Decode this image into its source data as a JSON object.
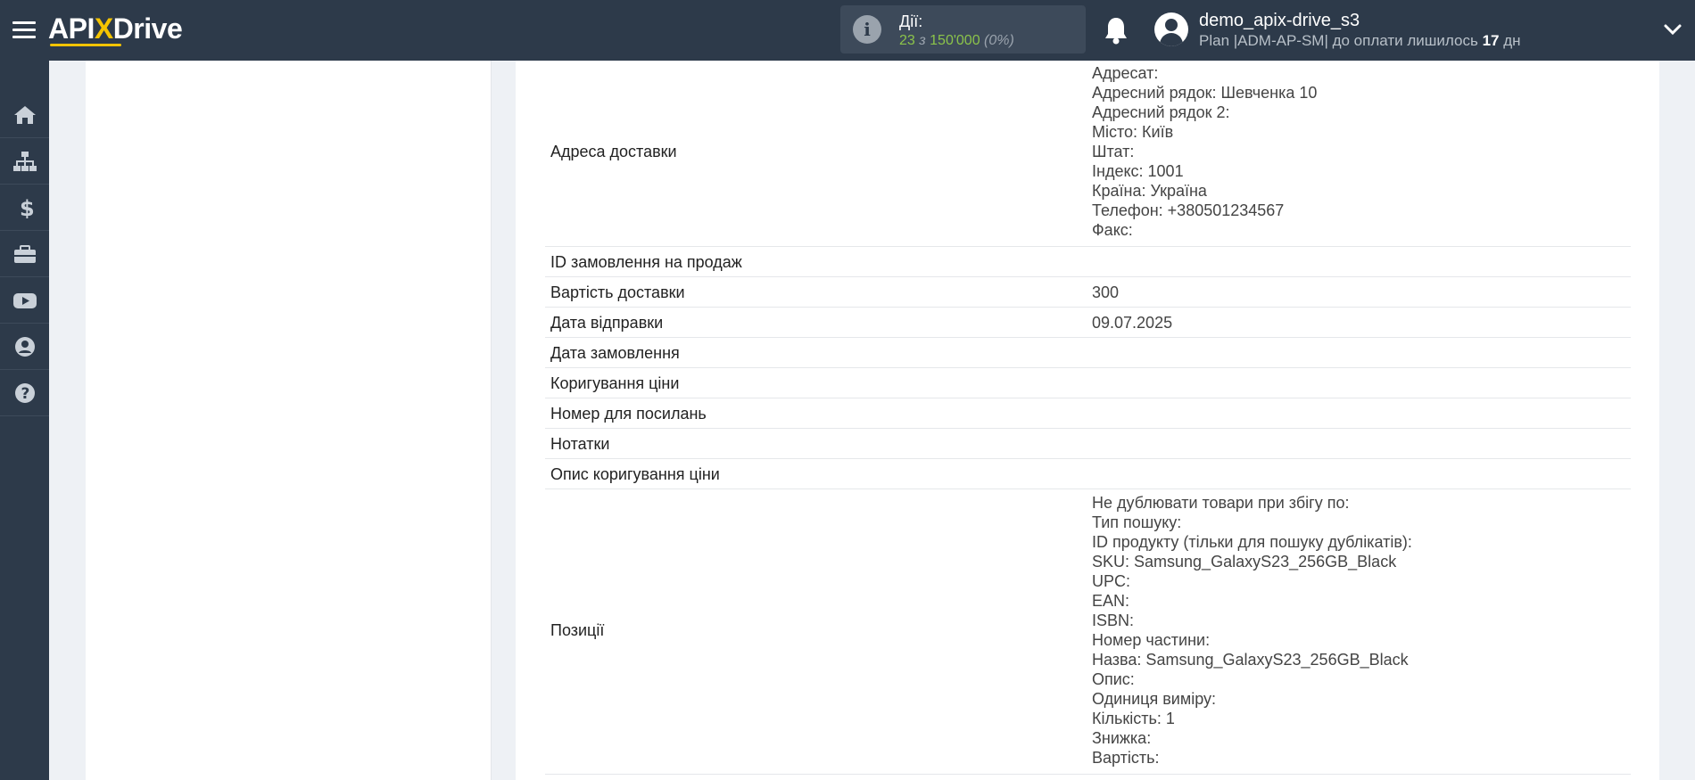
{
  "header": {
    "logo_prefix": "API",
    "logo_x": "X",
    "logo_suffix": "Drive",
    "actions_label": "Дії:",
    "actions_used": "23",
    "actions_of": "з",
    "actions_total": "150'000",
    "actions_percent": "(0%)",
    "user_name": "demo_apix-drive_s3",
    "plan_text": "Plan |ADM-AP-SM| до оплати лишилось",
    "days_left": "17",
    "days_unit": "дн"
  },
  "sidebar": {
    "items": [
      {
        "icon": "home-icon"
      },
      {
        "icon": "sitemap-icon"
      },
      {
        "icon": "dollar-icon"
      },
      {
        "icon": "briefcase-icon"
      },
      {
        "icon": "youtube-icon"
      },
      {
        "icon": "user-circle-icon"
      },
      {
        "icon": "question-circle-icon"
      }
    ]
  },
  "fields": {
    "shipping_address": {
      "label": "Адреса доставки",
      "lines": [
        "Адресат:",
        "Адресний рядок: Шевченка 10",
        "Адресний рядок 2:",
        "Місто: Київ",
        "Штат:",
        "Індекс: 1001",
        "Країна: Україна",
        "Телефон: +380501234567",
        "Факс:"
      ]
    },
    "sales_order_id": {
      "label": "ID замовлення на продаж",
      "value": ""
    },
    "shipping_cost": {
      "label": "Вартість доставки",
      "value": "300"
    },
    "ship_date": {
      "label": "Дата відправки",
      "value": "09.07.2025"
    },
    "order_date": {
      "label": "Дата замовлення",
      "value": ""
    },
    "price_adjustment": {
      "label": "Коригування ціни",
      "value": ""
    },
    "reference_number": {
      "label": "Номер для посилань",
      "value": ""
    },
    "notes": {
      "label": "Нотатки",
      "value": ""
    },
    "adjustment_description": {
      "label": "Опис коригування ціни",
      "value": ""
    },
    "positions": {
      "label": "Позиції",
      "lines": [
        "Не дублювати товари при збігу по:",
        "Тип пошуку:",
        "ID продукту (тільки для пошуку дублікатів):",
        "SKU: Samsung_GalaxyS23_256GB_Black",
        "UPC:",
        "EAN:",
        "ISBN:",
        "Номер частини:",
        "Назва: Samsung_GalaxyS23_256GB_Black",
        "Опис:",
        "Одиниця виміру:",
        "Кількість: 1",
        "Знижка:",
        "Вартість:"
      ]
    }
  }
}
